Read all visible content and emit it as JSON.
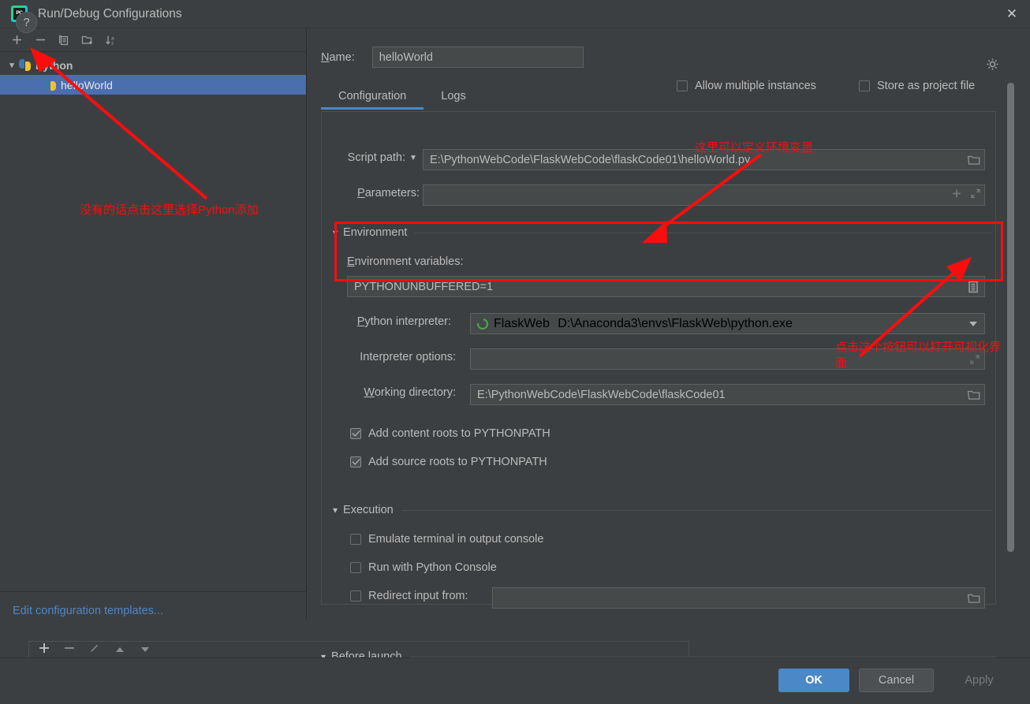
{
  "window": {
    "title": "Run/Debug Configurations",
    "app_icon": "pycharm-icon",
    "close_icon": "close-icon"
  },
  "sidebar": {
    "toolbar": [
      {
        "name": "add-configuration-button",
        "icon": "plus-icon"
      },
      {
        "name": "remove-configuration-button",
        "icon": "minus-icon"
      },
      {
        "name": "copy-configuration-button",
        "icon": "copy-icon"
      },
      {
        "name": "new-folder-button",
        "icon": "folder-add-icon"
      },
      {
        "name": "sort-configurations-button",
        "icon": "sort-alpha-icon"
      }
    ],
    "tree": {
      "group_label": "Python",
      "group_expanded_icon": "chevron-down-icon",
      "child_label": "helloWorld",
      "child_selected": true
    },
    "edit_templates_link": "Edit configuration templates..."
  },
  "header": {
    "name_label": "Name:",
    "name_value": "helloWorld",
    "allow_multiple_instances_label": "Allow multiple instances",
    "allow_multiple_instances_checked": false,
    "store_as_project_file_label": "Store as project file",
    "store_as_project_file_checked": false,
    "gear_icon": "gear-icon"
  },
  "tabs": [
    {
      "label": "Configuration",
      "active": true
    },
    {
      "label": "Logs",
      "active": false
    }
  ],
  "configuration": {
    "script_path_label": "Script path:",
    "script_path_dropdown_icon": "chevron-down-icon",
    "script_path_value": "E:\\PythonWebCode\\FlaskWebCode\\flaskCode01\\helloWorld.py",
    "script_path_browse_icon": "folder-icon",
    "parameters_label": "Parameters:",
    "parameters_value": "",
    "parameters_add_icon": "plus-icon",
    "parameters_expand_icon": "expand-icon",
    "environment_section_label": "Environment",
    "environment_section_chevron": "chevron-down-icon",
    "environment_variables_label": "Environment variables:",
    "environment_variables_value": "PYTHONUNBUFFERED=1",
    "environment_variables_edit_icon": "list-edit-icon",
    "python_interpreter_label": "Python interpreter:",
    "python_interpreter_name": "FlaskWeb",
    "python_interpreter_path": "D:\\Anaconda3\\envs\\FlaskWeb\\python.exe",
    "python_interpreter_env_icon": "conda-env-icon",
    "python_interpreter_caret": "chevron-down-icon",
    "interpreter_options_label": "Interpreter options:",
    "interpreter_options_value": "",
    "interpreter_options_expand_icon": "expand-icon",
    "working_directory_label": "Working directory:",
    "working_directory_value": "E:\\PythonWebCode\\FlaskWebCode\\flaskCode01",
    "working_directory_browse_icon": "folder-icon",
    "add_content_roots_label": "Add content roots to PYTHONPATH",
    "add_content_roots_checked": true,
    "add_source_roots_label": "Add source roots to PYTHONPATH",
    "add_source_roots_checked": true,
    "execution_section_label": "Execution",
    "execution_section_chevron": "chevron-down-icon",
    "emulate_terminal_label": "Emulate terminal in output console",
    "emulate_terminal_checked": false,
    "run_with_python_console_label": "Run with Python Console",
    "run_with_python_console_checked": false,
    "redirect_input_label": "Redirect input from:",
    "redirect_input_checked": false,
    "redirect_input_value": "",
    "redirect_input_browse_icon": "folder-icon"
  },
  "before_launch": {
    "section_label": "Before launch",
    "section_chevron": "chevron-down-icon",
    "toolbar": [
      {
        "name": "before-launch-add-button",
        "icon": "plus-icon"
      },
      {
        "name": "before-launch-remove-button",
        "icon": "minus-icon"
      },
      {
        "name": "before-launch-edit-button",
        "icon": "pencil-icon"
      },
      {
        "name": "before-launch-move-up-button",
        "icon": "triangle-up-icon"
      },
      {
        "name": "before-launch-move-down-button",
        "icon": "triangle-down-icon"
      }
    ]
  },
  "footer": {
    "help_label": "?",
    "ok_label": "OK",
    "cancel_label": "Cancel",
    "apply_label": "Apply",
    "apply_enabled": false
  },
  "annotations": [
    {
      "id": "annotation-add-python",
      "text": "没有的话点击这里选择Python添加",
      "arrow_to": "sidebar python tree group"
    },
    {
      "id": "annotation-define-env-vars",
      "text": "这里可以定义环境变量",
      "arrow_to": "environment variables field"
    },
    {
      "id": "annotation-open-visual-editor",
      "text": "点击这个按钮可以打开可视化界\n面",
      "arrow_to": "environment variables edit button"
    }
  ],
  "colors": {
    "accent": "#4a88c7",
    "annotation_red": "#fb0d0d",
    "background": "#3c3f41",
    "field_background": "#45494a",
    "selection": "#4b6eaf",
    "link": "#4e86c8"
  }
}
